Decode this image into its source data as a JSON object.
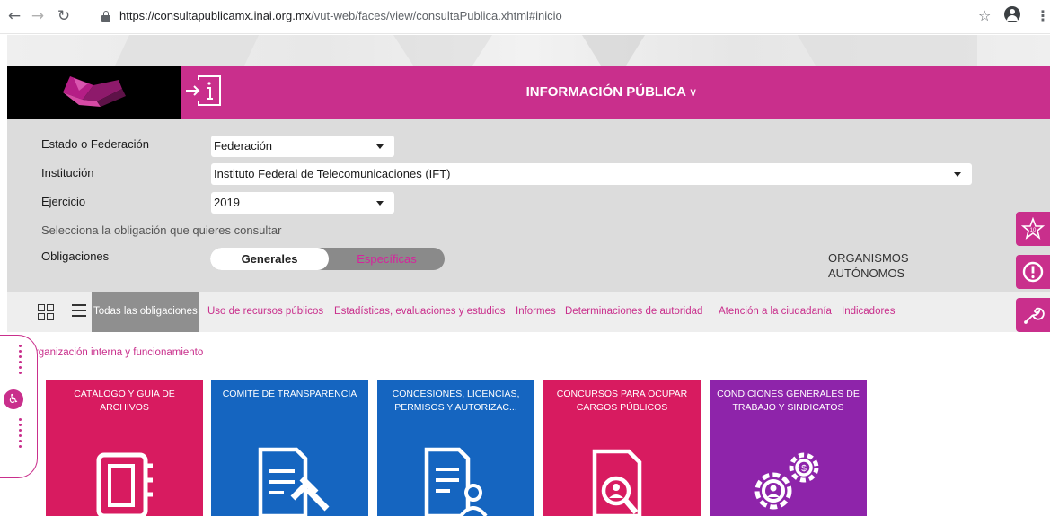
{
  "browser": {
    "back_icon": "arrow-left-icon",
    "forward_icon": "arrow-right-icon",
    "reload_icon": "reload-icon",
    "url_host": "https://consultapublicamx.inai.org.mx",
    "url_path": "/vut-web/faces/view/consultaPublica.xhtml#inicio"
  },
  "header": {
    "title": "INFORMACIÓN PÚBLICA",
    "brand_color": "#c92f8c"
  },
  "filters": {
    "estado_label": "Estado o Federación",
    "estado_value": "Federación",
    "institucion_label": "Institución",
    "institucion_value": "Instituto Federal de Telecomunicaciones (IFT)",
    "ejercicio_label": "Ejercicio",
    "ejercicio_value": "2019",
    "hint": "Selecciona la obligación que quieres consultar",
    "obligaciones_label": "Obligaciones",
    "toggle_on": "Generales",
    "toggle_off": "Específicas",
    "org_line1": "ORGANISMOS",
    "org_line2": "AUTÓNOMOS"
  },
  "categories": {
    "active": "Todas las obligaciones",
    "items": [
      "Uso de recursos públicos",
      "Estadísticas, evaluaciones y estudios",
      "Informes",
      "Determinaciones de autoridad",
      "Atención a la ciudadanía",
      "Indicadores"
    ],
    "second_row": "Organización interna y funcionamiento"
  },
  "cards": [
    {
      "title_line1": "CATÁLOGO Y GUÍA DE ARCHIVOS",
      "title_line2": "",
      "color": "#d81b60",
      "icon": "binder-icon"
    },
    {
      "title_line1": "COMITÉ DE TRANSPARENCIA",
      "title_line2": "",
      "color": "#1565c0",
      "icon": "document-gavel-icon"
    },
    {
      "title_line1": "CONCESIONES, LICENCIAS,",
      "title_line2": "PERMISOS Y AUTORIZAC...",
      "color": "#1565c0",
      "icon": "document-person-icon"
    },
    {
      "title_line1": "CONCURSOS PARA OCUPAR",
      "title_line2": "CARGOS PÚBLICOS",
      "color": "#d81b60",
      "icon": "document-search-icon"
    },
    {
      "title_line1": "CONDICIONES GENERALES DE",
      "title_line2": "TRABAJO Y SINDICATOS",
      "color": "#8e24aa",
      "icon": "gears-person-icon"
    }
  ],
  "side_buttons": [
    "star-10-icon",
    "alert-icon",
    "wrench-icon"
  ]
}
